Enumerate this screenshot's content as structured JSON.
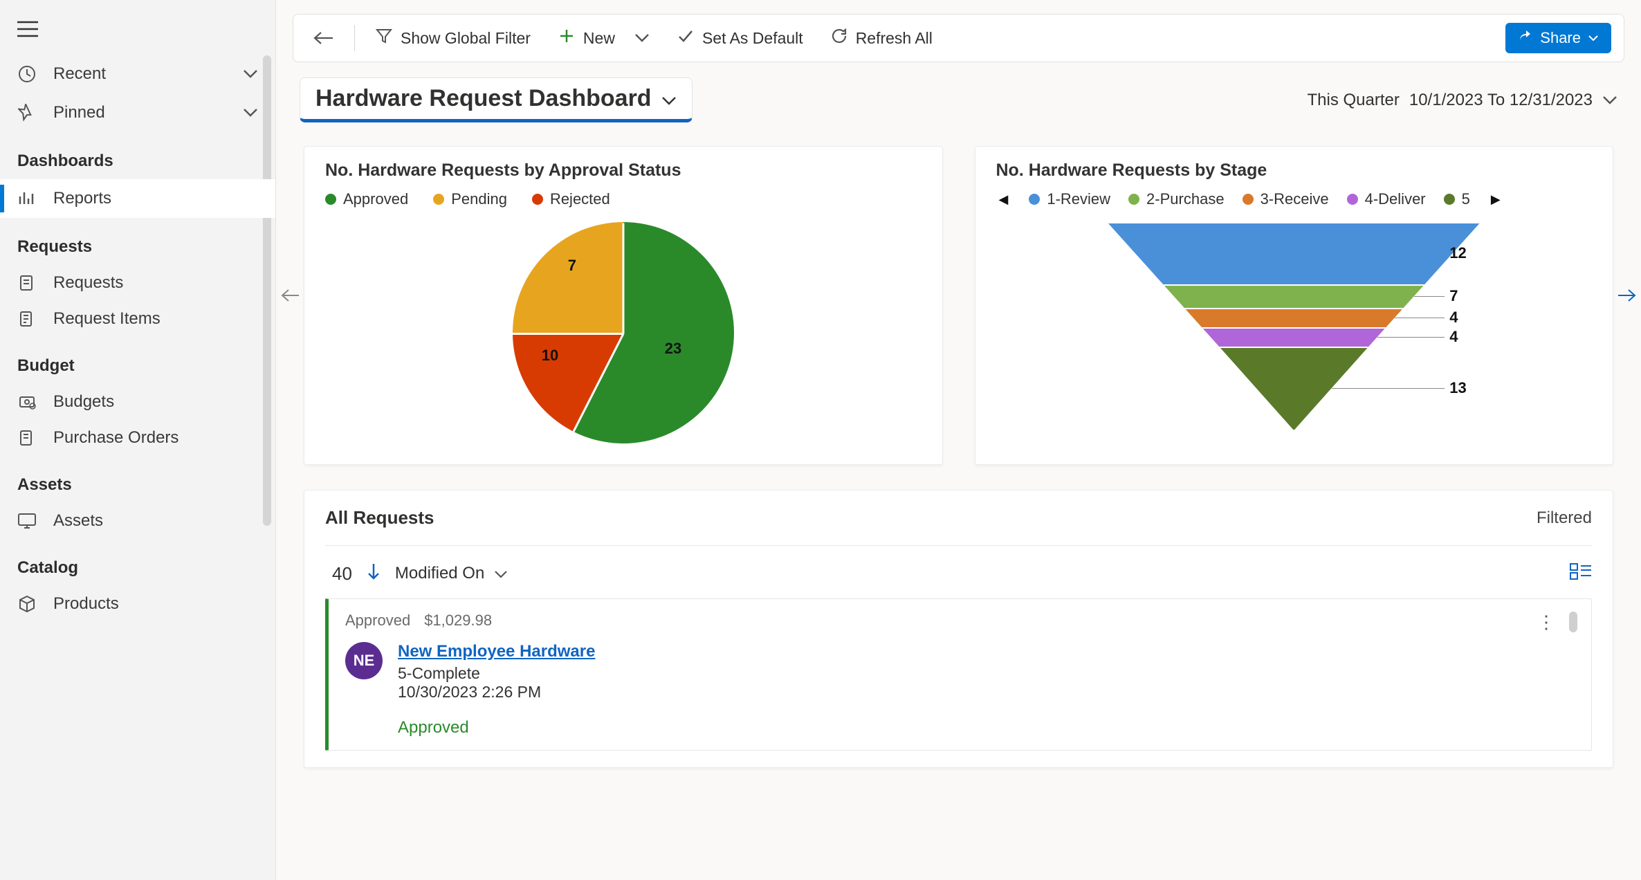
{
  "sidebar": {
    "recent": "Recent",
    "pinned": "Pinned",
    "sections": {
      "dashboards": "Dashboards",
      "requests": "Requests",
      "budget": "Budget",
      "assets": "Assets",
      "catalog": "Catalog"
    },
    "items": {
      "reports": "Reports",
      "requests": "Requests",
      "request_items": "Request Items",
      "budgets": "Budgets",
      "purchase_orders": "Purchase Orders",
      "assets": "Assets",
      "products": "Products"
    }
  },
  "commandbar": {
    "show_filter": "Show Global Filter",
    "new": "New",
    "set_default": "Set As Default",
    "refresh": "Refresh All",
    "share": "Share"
  },
  "title": "Hardware Request Dashboard",
  "timeframe": {
    "label": "This Quarter",
    "range": "10/1/2023 To 12/31/2023"
  },
  "card_pie": {
    "title": "No. Hardware Requests by Approval Status",
    "legend": [
      "Approved",
      "Pending",
      "Rejected"
    ]
  },
  "card_funnel": {
    "title": "No. Hardware Requests by Stage",
    "legend": [
      "1-Review",
      "2-Purchase",
      "3-Receive",
      "4-Deliver"
    ],
    "legend_overflow": "5"
  },
  "requests": {
    "heading": "All Requests",
    "filtered": "Filtered",
    "count": "40",
    "sort_field": "Modified On",
    "item": {
      "status_top": "Approved",
      "amount": "$1,029.98",
      "avatar": "NE",
      "title": "New Employee Hardware",
      "stage": "5-Complete",
      "date": "10/30/2023 2:26 PM",
      "status_bottom": "Approved"
    }
  },
  "colors": {
    "approved": "#2a8a2a",
    "pending": "#e7a51f",
    "rejected": "#d83b01",
    "review": "#4a90d9",
    "purchase": "#7fb24c",
    "receive": "#d87a2a",
    "deliver": "#b066d9",
    "stage5": "#5a7a2a"
  },
  "chart_data": [
    {
      "type": "pie",
      "title": "No. Hardware Requests by Approval Status",
      "categories": [
        "Approved",
        "Pending",
        "Rejected"
      ],
      "values": [
        23,
        10,
        7
      ],
      "colors": [
        "#2a8a2a",
        "#e7a51f",
        "#d83b01"
      ]
    },
    {
      "type": "funnel",
      "title": "No. Hardware Requests by Stage",
      "categories": [
        "1-Review",
        "2-Purchase",
        "3-Receive",
        "4-Deliver",
        "5-Complete"
      ],
      "values": [
        12,
        7,
        4,
        4,
        13
      ],
      "colors": [
        "#4a90d9",
        "#7fb24c",
        "#d87a2a",
        "#b066d9",
        "#5a7a2a"
      ]
    }
  ]
}
